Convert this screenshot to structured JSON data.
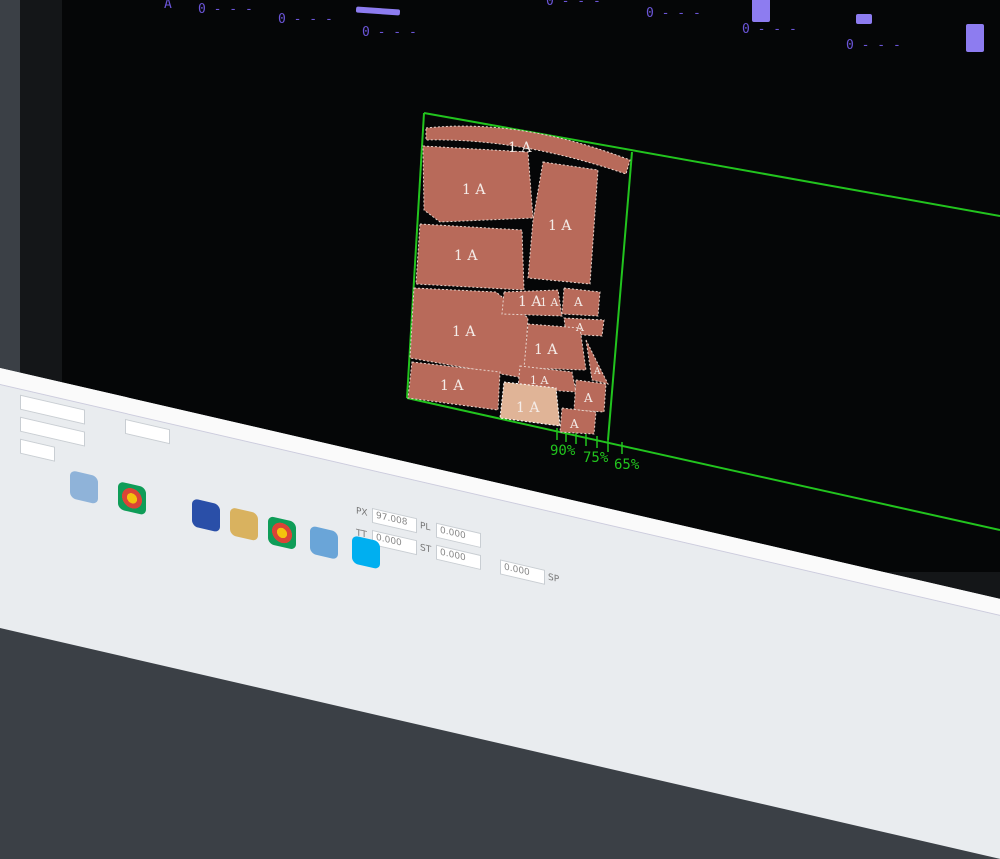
{
  "header_markers": [
    {
      "text": "A",
      "color": "#6b55d8"
    },
    {
      "text": "0 - - -",
      "color": "#6b55d8"
    },
    {
      "text": "0 - - -",
      "color": "#6b55d8"
    },
    {
      "text": "0 - - -",
      "color": "#6b55d8"
    },
    {
      "text": "0 - - -",
      "color": "#6b55d8"
    },
    {
      "text": "0 - - -",
      "color": "#6b55d8"
    },
    {
      "text": "0 - - -",
      "color": "#6b55d8"
    },
    {
      "text": "0 - - -",
      "color": "#6b55d8"
    }
  ],
  "pieces": [
    {
      "label": "1 A"
    },
    {
      "label": "1 A"
    },
    {
      "label": "1 A"
    },
    {
      "label": "1 A"
    },
    {
      "label": "1 A"
    },
    {
      "label": "1 A"
    },
    {
      "label": "1 A"
    },
    {
      "label": "1 A"
    },
    {
      "label": "1 A"
    },
    {
      "label": "1 A"
    },
    {
      "label": "1 A"
    },
    {
      "label": "A"
    },
    {
      "label": "A"
    },
    {
      "label": "A"
    },
    {
      "label": "A"
    },
    {
      "label": "A"
    }
  ],
  "efficiency_labels": [
    "90%",
    "75%",
    "65%"
  ],
  "colors": {
    "background": "#050607",
    "piece_fill": "#b86a5a",
    "piece_selected": "#e0b497",
    "marker_border": "#22c41e",
    "header_text": "#6b55d8"
  },
  "fields": [
    {
      "label": "PX",
      "value": "97.008"
    },
    {
      "label": "PL",
      "value": "0.000"
    },
    {
      "label": "TT",
      "value": "0.000"
    },
    {
      "label": "ST",
      "value": "0.000"
    },
    {
      "label": "SP",
      "value": "0.000"
    }
  ],
  "taskbar_icons": [
    "folder-icon",
    "chrome-icon",
    "windows-icon",
    "explorer-icon",
    "app-icon",
    "skype-icon"
  ]
}
